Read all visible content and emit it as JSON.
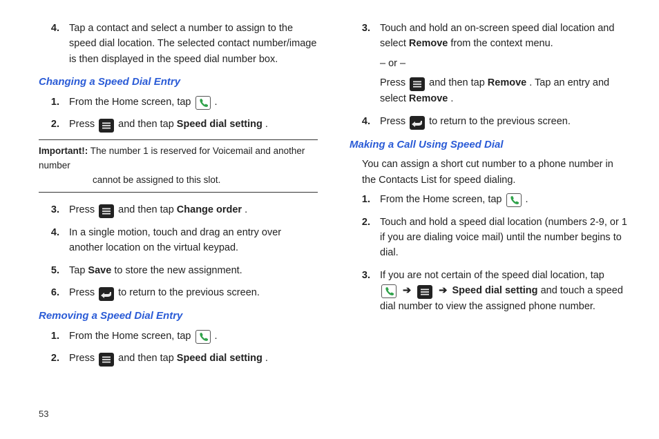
{
  "page_number": "53",
  "col1": {
    "step4_top": "Tap a contact and select a number to assign to the speed dial location. The selected contact number/image is then displayed in the speed dial number box.",
    "heading_change": "Changing a Speed Dial Entry",
    "change_1_a": "From the Home screen, tap ",
    "change_1_b": " .",
    "change_2_a": "Press ",
    "change_2_b": " and then tap ",
    "change_2_c": "Speed dial setting",
    "change_2_d": ".",
    "important_label": "Important!:",
    "important_a": " The number 1 is reserved for Voicemail and another number",
    "important_b": "cannot be assigned to this slot.",
    "change_3_a": "Press ",
    "change_3_b": " and then tap ",
    "change_3_c": "Change order",
    "change_3_d": ".",
    "change_4": "In a single motion, touch and drag an entry over another location on the virtual keypad.",
    "change_5_a": "Tap ",
    "change_5_b": "Save",
    "change_5_c": " to store the new assignment.",
    "change_6_a": "Press ",
    "change_6_b": " to return to the previous screen.",
    "heading_remove": "Removing a Speed Dial Entry",
    "remove_1_a": "From the Home screen, tap ",
    "remove_1_b": " .",
    "remove_2_a": "Press ",
    "remove_2_b": " and then tap ",
    "remove_2_c": "Speed dial setting",
    "remove_2_d": "."
  },
  "col2": {
    "remove_3_a": "Touch and hold an on-screen speed dial location and select ",
    "remove_3_b": "Remove",
    "remove_3_c": " from the context menu.",
    "remove_or": "– or –",
    "remove_3_d": "Press ",
    "remove_3_e": " and then tap ",
    "remove_3_f": "Remove",
    "remove_3_g": ". Tap an entry and select ",
    "remove_3_h": "Remove",
    "remove_3_i": ".",
    "remove_4_a": "Press ",
    "remove_4_b": " to return to the previous screen.",
    "heading_call": "Making a Call Using Speed Dial",
    "call_intro": "You can assign a short cut number to a phone number in the Contacts List for speed dialing.",
    "call_1_a": "From the Home screen, tap ",
    "call_1_b": " .",
    "call_2": "Touch and hold a speed dial location (numbers 2-9, or 1 if you are dialing voice mail) until the number begins to dial.",
    "call_3_a": "If you are not certain of the speed dial location, tap ",
    "call_3_b": "Speed dial setting",
    "call_3_c": " and touch a speed dial number to view the assigned phone number.",
    "arrow": "➔"
  },
  "nums": {
    "n1": "1.",
    "n2": "2.",
    "n3": "3.",
    "n4": "4.",
    "n5": "5.",
    "n6": "6."
  }
}
